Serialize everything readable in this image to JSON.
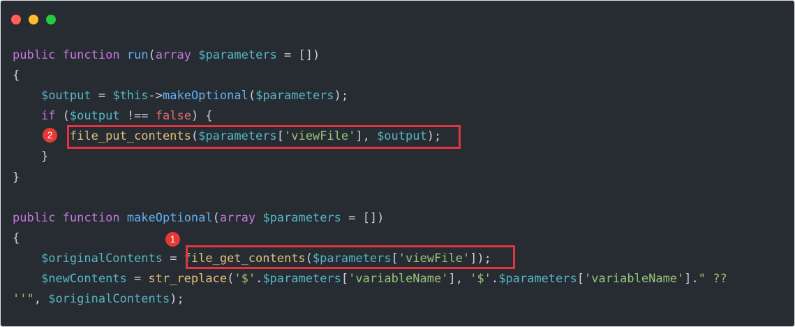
{
  "window": {
    "controls": [
      {
        "name": "close",
        "color": "#ff5f56"
      },
      {
        "name": "minimize",
        "color": "#ffbd2e"
      },
      {
        "name": "zoom",
        "color": "#27c93f"
      }
    ]
  },
  "colors": {
    "background": "#272c33",
    "keyword": "#c678dd",
    "function": "#61afef",
    "variable": "#56b6c2",
    "builtin": "#e5c07b",
    "string": "#98c379",
    "boolean": "#e06c75",
    "highlight": "#e0353c"
  },
  "code": {
    "lines": [
      [
        {
          "t": "kw",
          "v": "public"
        },
        {
          "t": "pn",
          "v": " "
        },
        {
          "t": "kw",
          "v": "function"
        },
        {
          "t": "pn",
          "v": " "
        },
        {
          "t": "fn",
          "v": "run"
        },
        {
          "t": "pn",
          "v": "("
        },
        {
          "t": "tp",
          "v": "array"
        },
        {
          "t": "pn",
          "v": " "
        },
        {
          "t": "vr",
          "v": "$parameters"
        },
        {
          "t": "op",
          "v": " = "
        },
        {
          "t": "pn",
          "v": "[])"
        }
      ],
      [
        {
          "t": "pn",
          "v": "{"
        }
      ],
      [
        {
          "t": "pn",
          "v": "    "
        },
        {
          "t": "vr",
          "v": "$output"
        },
        {
          "t": "op",
          "v": " = "
        },
        {
          "t": "vr",
          "v": "$this"
        },
        {
          "t": "op",
          "v": "->"
        },
        {
          "t": "fn",
          "v": "makeOptional"
        },
        {
          "t": "pn",
          "v": "("
        },
        {
          "t": "vr",
          "v": "$parameters"
        },
        {
          "t": "pn",
          "v": ");"
        }
      ],
      [
        {
          "t": "pn",
          "v": "    "
        },
        {
          "t": "kw",
          "v": "if"
        },
        {
          "t": "pn",
          "v": " ("
        },
        {
          "t": "vr",
          "v": "$output"
        },
        {
          "t": "op",
          "v": " !== "
        },
        {
          "t": "bl",
          "v": "false"
        },
        {
          "t": "pn",
          "v": ") {"
        }
      ],
      [
        {
          "t": "pn",
          "v": "        "
        },
        {
          "t": "bf",
          "v": "file_put_contents"
        },
        {
          "t": "pn",
          "v": "("
        },
        {
          "t": "vr",
          "v": "$parameters"
        },
        {
          "t": "pn",
          "v": "["
        },
        {
          "t": "st",
          "v": "'viewFile'"
        },
        {
          "t": "pn",
          "v": "], "
        },
        {
          "t": "vr",
          "v": "$output"
        },
        {
          "t": "pn",
          "v": ");"
        }
      ],
      [
        {
          "t": "pn",
          "v": "    }"
        }
      ],
      [
        {
          "t": "pn",
          "v": "}"
        }
      ],
      [
        {
          "t": "pn",
          "v": ""
        }
      ],
      [
        {
          "t": "kw",
          "v": "public"
        },
        {
          "t": "pn",
          "v": " "
        },
        {
          "t": "kw",
          "v": "function"
        },
        {
          "t": "pn",
          "v": " "
        },
        {
          "t": "fn",
          "v": "makeOptional"
        },
        {
          "t": "pn",
          "v": "("
        },
        {
          "t": "tp",
          "v": "array"
        },
        {
          "t": "pn",
          "v": " "
        },
        {
          "t": "vr",
          "v": "$parameters"
        },
        {
          "t": "op",
          "v": " = "
        },
        {
          "t": "pn",
          "v": "[])"
        }
      ],
      [
        {
          "t": "pn",
          "v": "{"
        }
      ],
      [
        {
          "t": "pn",
          "v": "    "
        },
        {
          "t": "vr",
          "v": "$originalContents"
        },
        {
          "t": "op",
          "v": " = "
        },
        {
          "t": "bf",
          "v": "file_get_contents"
        },
        {
          "t": "pn",
          "v": "("
        },
        {
          "t": "vr",
          "v": "$parameters"
        },
        {
          "t": "pn",
          "v": "["
        },
        {
          "t": "st",
          "v": "'viewFile'"
        },
        {
          "t": "pn",
          "v": "]);"
        }
      ],
      [
        {
          "t": "pn",
          "v": "    "
        },
        {
          "t": "vr",
          "v": "$newContents"
        },
        {
          "t": "op",
          "v": " = "
        },
        {
          "t": "bf",
          "v": "str_replace"
        },
        {
          "t": "pn",
          "v": "("
        },
        {
          "t": "st",
          "v": "'$'"
        },
        {
          "t": "op",
          "v": "."
        },
        {
          "t": "vr",
          "v": "$parameters"
        },
        {
          "t": "pn",
          "v": "["
        },
        {
          "t": "st",
          "v": "'variableName'"
        },
        {
          "t": "pn",
          "v": "], "
        },
        {
          "t": "st",
          "v": "'$'"
        },
        {
          "t": "op",
          "v": "."
        },
        {
          "t": "vr",
          "v": "$parameters"
        },
        {
          "t": "pn",
          "v": "["
        },
        {
          "t": "st",
          "v": "'variableName'"
        },
        {
          "t": "pn",
          "v": "]."
        },
        {
          "t": "st",
          "v": "\" ??"
        }
      ],
      [
        {
          "t": "st",
          "v": "''\""
        },
        {
          "t": "pn",
          "v": ", "
        },
        {
          "t": "vr",
          "v": "$originalContents"
        },
        {
          "t": "pn",
          "v": ");"
        }
      ]
    ]
  },
  "annotations": [
    {
      "label": "2",
      "line": 4
    },
    {
      "label": "1",
      "line": 10
    }
  ]
}
